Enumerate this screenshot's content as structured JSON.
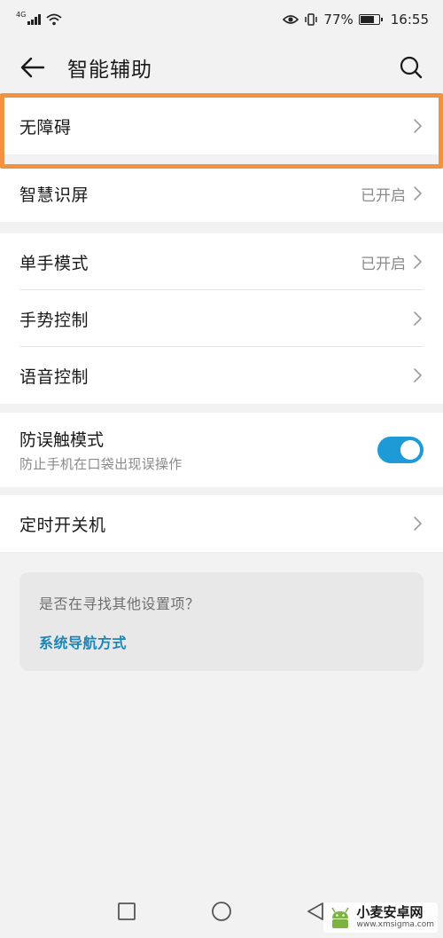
{
  "status": {
    "network_tag": "4G",
    "battery": "77%",
    "battery_level": 0.77,
    "time": "16:55"
  },
  "header": {
    "title": "智能辅助"
  },
  "group1": {
    "items": [
      {
        "label": "无障碍",
        "value": ""
      },
      {
        "label": "智慧识屏",
        "value": "已开启"
      }
    ]
  },
  "group2": {
    "items": [
      {
        "label": "单手模式",
        "value": "已开启"
      },
      {
        "label": "手势控制",
        "value": ""
      },
      {
        "label": "语音控制",
        "value": ""
      }
    ]
  },
  "group3": {
    "title": "防误触模式",
    "subtitle": "防止手机在口袋出现误操作",
    "enabled": true
  },
  "group4": {
    "label": "定时开关机"
  },
  "suggest": {
    "question": "是否在寻找其他设置项？",
    "link": "系统导航方式"
  },
  "watermark": {
    "name": "小麦安卓网",
    "url": "www.xmsigma.com"
  },
  "colors": {
    "accent": "#1e9bd6",
    "link": "#1b86b8",
    "highlight": "#f0923e"
  }
}
